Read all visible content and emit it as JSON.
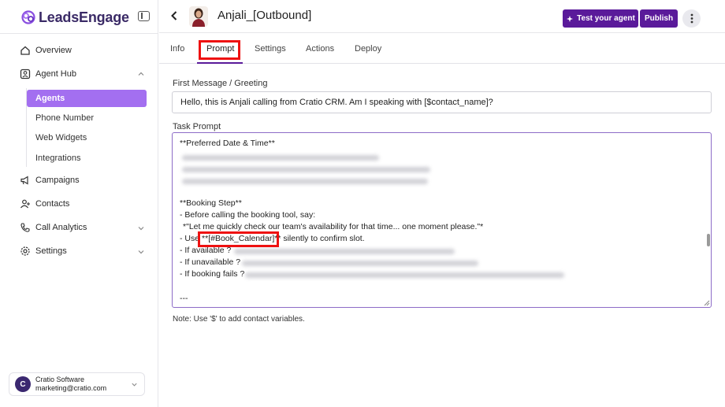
{
  "brand": {
    "name": "LeadsEngage"
  },
  "sidebar": {
    "items": [
      {
        "label": "Overview",
        "icon": "home-icon"
      },
      {
        "label": "Agent Hub",
        "icon": "agent-hub-icon"
      },
      {
        "label": "Campaigns",
        "icon": "megaphone-icon"
      },
      {
        "label": "Contacts",
        "icon": "contacts-icon"
      },
      {
        "label": "Call Analytics",
        "icon": "call-analytics-icon"
      },
      {
        "label": "Settings",
        "icon": "gear-icon"
      }
    ],
    "subitems": [
      {
        "label": "Agents",
        "active": true
      },
      {
        "label": "Phone Number"
      },
      {
        "label": "Web Widgets"
      },
      {
        "label": "Integrations"
      }
    ]
  },
  "account": {
    "initial": "C",
    "name": "Cratio Software",
    "email": "marketing@cratio.com"
  },
  "header": {
    "title": "Anjali_[Outbound]",
    "test_label": "Test your agent",
    "publish_label": "Publish"
  },
  "tabs": [
    "Info",
    "Prompt",
    "Settings",
    "Actions",
    "Deploy"
  ],
  "active_tab": "Prompt",
  "form": {
    "greeting_label": "First Message / Greeting",
    "greeting_value": "Hello, this is Anjali calling from Cratio CRM. Am I speaking with [$contact_name]?",
    "task_label": "Task Prompt",
    "task_lines": {
      "l1": "**Preferred Date & Time**",
      "l2": "**Booking Step**",
      "l3": "- Before calling the booking tool, say:",
      "l4": "*\"Let me quickly check our team's availability for that time... one moment please.\"*",
      "l5a": "- Use ",
      "l5b": "**[#Book_Calendar]**",
      "l5c": " silently to confirm slot.",
      "l6": "- If available ?",
      "l7": "- If unavailable ?",
      "l8": "- If booking fails ?",
      "l9": "---"
    },
    "note": "Note: Use '$' to add contact variables."
  },
  "colors": {
    "accent": "#5a1a9a",
    "active_item": "#a36ff0",
    "highlight": "#ee1111"
  }
}
